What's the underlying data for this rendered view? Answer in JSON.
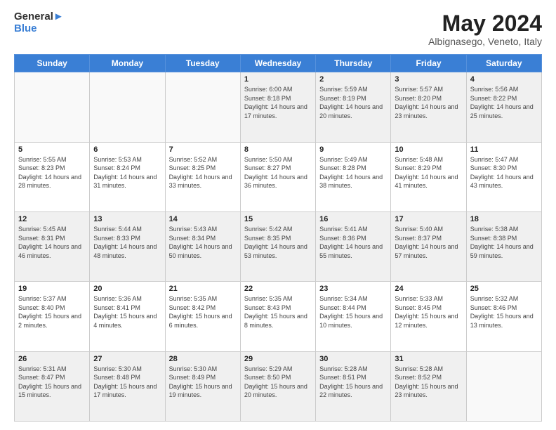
{
  "header": {
    "logo_line1": "General",
    "logo_line2": "Blue",
    "month_title": "May 2024",
    "location": "Albignasego, Veneto, Italy"
  },
  "days_of_week": [
    "Sunday",
    "Monday",
    "Tuesday",
    "Wednesday",
    "Thursday",
    "Friday",
    "Saturday"
  ],
  "weeks": [
    [
      {
        "day": "",
        "info": ""
      },
      {
        "day": "",
        "info": ""
      },
      {
        "day": "",
        "info": ""
      },
      {
        "day": "1",
        "info": "Sunrise: 6:00 AM\nSunset: 8:18 PM\nDaylight: 14 hours\nand 17 minutes."
      },
      {
        "day": "2",
        "info": "Sunrise: 5:59 AM\nSunset: 8:19 PM\nDaylight: 14 hours\nand 20 minutes."
      },
      {
        "day": "3",
        "info": "Sunrise: 5:57 AM\nSunset: 8:20 PM\nDaylight: 14 hours\nand 23 minutes."
      },
      {
        "day": "4",
        "info": "Sunrise: 5:56 AM\nSunset: 8:22 PM\nDaylight: 14 hours\nand 25 minutes."
      }
    ],
    [
      {
        "day": "5",
        "info": "Sunrise: 5:55 AM\nSunset: 8:23 PM\nDaylight: 14 hours\nand 28 minutes."
      },
      {
        "day": "6",
        "info": "Sunrise: 5:53 AM\nSunset: 8:24 PM\nDaylight: 14 hours\nand 31 minutes."
      },
      {
        "day": "7",
        "info": "Sunrise: 5:52 AM\nSunset: 8:25 PM\nDaylight: 14 hours\nand 33 minutes."
      },
      {
        "day": "8",
        "info": "Sunrise: 5:50 AM\nSunset: 8:27 PM\nDaylight: 14 hours\nand 36 minutes."
      },
      {
        "day": "9",
        "info": "Sunrise: 5:49 AM\nSunset: 8:28 PM\nDaylight: 14 hours\nand 38 minutes."
      },
      {
        "day": "10",
        "info": "Sunrise: 5:48 AM\nSunset: 8:29 PM\nDaylight: 14 hours\nand 41 minutes."
      },
      {
        "day": "11",
        "info": "Sunrise: 5:47 AM\nSunset: 8:30 PM\nDaylight: 14 hours\nand 43 minutes."
      }
    ],
    [
      {
        "day": "12",
        "info": "Sunrise: 5:45 AM\nSunset: 8:31 PM\nDaylight: 14 hours\nand 46 minutes."
      },
      {
        "day": "13",
        "info": "Sunrise: 5:44 AM\nSunset: 8:33 PM\nDaylight: 14 hours\nand 48 minutes."
      },
      {
        "day": "14",
        "info": "Sunrise: 5:43 AM\nSunset: 8:34 PM\nDaylight: 14 hours\nand 50 minutes."
      },
      {
        "day": "15",
        "info": "Sunrise: 5:42 AM\nSunset: 8:35 PM\nDaylight: 14 hours\nand 53 minutes."
      },
      {
        "day": "16",
        "info": "Sunrise: 5:41 AM\nSunset: 8:36 PM\nDaylight: 14 hours\nand 55 minutes."
      },
      {
        "day": "17",
        "info": "Sunrise: 5:40 AM\nSunset: 8:37 PM\nDaylight: 14 hours\nand 57 minutes."
      },
      {
        "day": "18",
        "info": "Sunrise: 5:38 AM\nSunset: 8:38 PM\nDaylight: 14 hours\nand 59 minutes."
      }
    ],
    [
      {
        "day": "19",
        "info": "Sunrise: 5:37 AM\nSunset: 8:40 PM\nDaylight: 15 hours\nand 2 minutes."
      },
      {
        "day": "20",
        "info": "Sunrise: 5:36 AM\nSunset: 8:41 PM\nDaylight: 15 hours\nand 4 minutes."
      },
      {
        "day": "21",
        "info": "Sunrise: 5:35 AM\nSunset: 8:42 PM\nDaylight: 15 hours\nand 6 minutes."
      },
      {
        "day": "22",
        "info": "Sunrise: 5:35 AM\nSunset: 8:43 PM\nDaylight: 15 hours\nand 8 minutes."
      },
      {
        "day": "23",
        "info": "Sunrise: 5:34 AM\nSunset: 8:44 PM\nDaylight: 15 hours\nand 10 minutes."
      },
      {
        "day": "24",
        "info": "Sunrise: 5:33 AM\nSunset: 8:45 PM\nDaylight: 15 hours\nand 12 minutes."
      },
      {
        "day": "25",
        "info": "Sunrise: 5:32 AM\nSunset: 8:46 PM\nDaylight: 15 hours\nand 13 minutes."
      }
    ],
    [
      {
        "day": "26",
        "info": "Sunrise: 5:31 AM\nSunset: 8:47 PM\nDaylight: 15 hours\nand 15 minutes."
      },
      {
        "day": "27",
        "info": "Sunrise: 5:30 AM\nSunset: 8:48 PM\nDaylight: 15 hours\nand 17 minutes."
      },
      {
        "day": "28",
        "info": "Sunrise: 5:30 AM\nSunset: 8:49 PM\nDaylight: 15 hours\nand 19 minutes."
      },
      {
        "day": "29",
        "info": "Sunrise: 5:29 AM\nSunset: 8:50 PM\nDaylight: 15 hours\nand 20 minutes."
      },
      {
        "day": "30",
        "info": "Sunrise: 5:28 AM\nSunset: 8:51 PM\nDaylight: 15 hours\nand 22 minutes."
      },
      {
        "day": "31",
        "info": "Sunrise: 5:28 AM\nSunset: 8:52 PM\nDaylight: 15 hours\nand 23 minutes."
      },
      {
        "day": "",
        "info": ""
      }
    ]
  ]
}
